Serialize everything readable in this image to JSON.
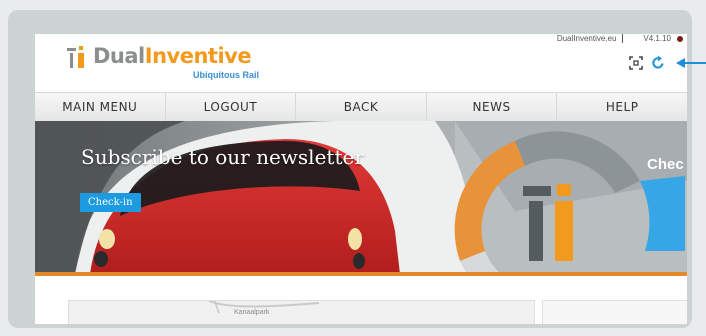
{
  "brand": {
    "name_part1": "Dual",
    "name_part2": "Inventive",
    "tagline": "Ubiquitous Rail",
    "color_primary": "#f29a1e",
    "color_secondary": "#8a8e8e",
    "color_tagline": "#3a8fd4"
  },
  "topbar": {
    "domain": "DualInventive.eu",
    "version": "V4.1.10"
  },
  "toolbar": {
    "icons": [
      "fullscreen-icon",
      "refresh-icon"
    ]
  },
  "nav": {
    "items": [
      {
        "label": "MAIN MENU"
      },
      {
        "label": "LOGOUT"
      },
      {
        "label": "BACK"
      },
      {
        "label": "NEWS"
      },
      {
        "label": "HELP"
      }
    ]
  },
  "banner": {
    "title": "Subscribe to our newsletter",
    "button_label": "Check-in",
    "right_label": "Chec",
    "accent_color": "#1d9be0",
    "bottom_bar_color": "#e2892b"
  },
  "map": {
    "label": "Kanaalpark"
  }
}
